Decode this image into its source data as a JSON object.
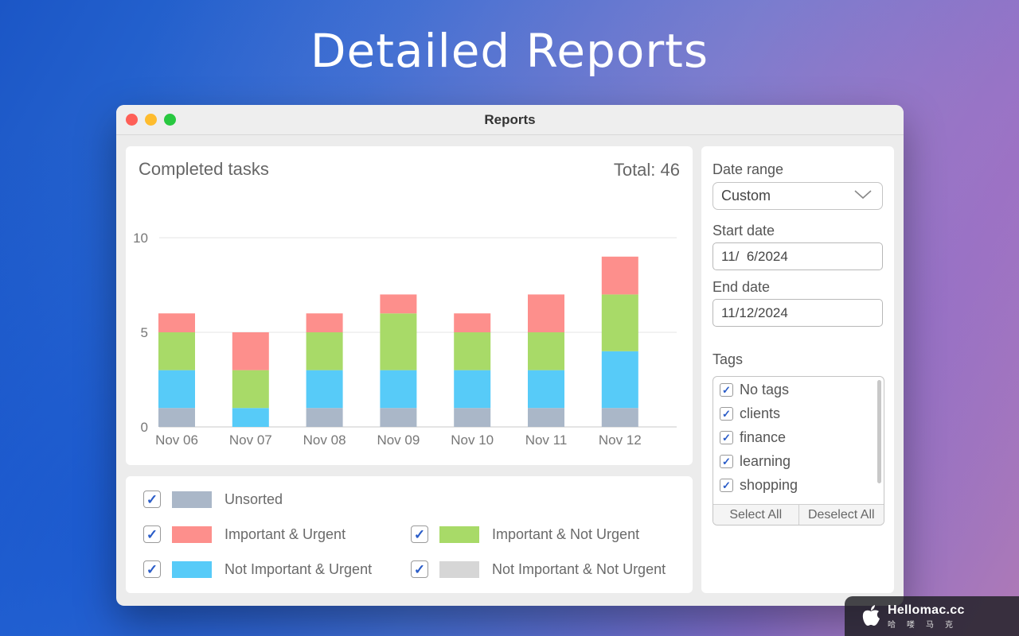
{
  "headline": "Detailed Reports",
  "window": {
    "title": "Reports"
  },
  "chart_panel": {
    "title": "Completed tasks",
    "total": "Total: 46"
  },
  "chart_data": {
    "type": "bar",
    "stacked": true,
    "title": "Completed tasks",
    "categories": [
      "Nov 06",
      "Nov 07",
      "Nov 08",
      "Nov 09",
      "Nov 10",
      "Nov 11",
      "Nov 12"
    ],
    "yticks": [
      0,
      5,
      10
    ],
    "ylim": [
      0,
      10
    ],
    "grid": true,
    "series": [
      {
        "name": "Unsorted",
        "color": "#aab7c8",
        "values": [
          1,
          0,
          1,
          1,
          1,
          1,
          1
        ]
      },
      {
        "name": "Not Important & Urgent",
        "color": "#57cbf8",
        "values": [
          2,
          1,
          2,
          2,
          2,
          2,
          3
        ]
      },
      {
        "name": "Important & Not Urgent",
        "color": "#a8da68",
        "values": [
          2,
          2,
          2,
          3,
          2,
          2,
          3
        ]
      },
      {
        "name": "Important & Urgent",
        "color": "#fd8f8c",
        "values": [
          1,
          2,
          1,
          1,
          1,
          2,
          2
        ]
      }
    ]
  },
  "legend": {
    "checkmark": "✓",
    "items": [
      {
        "label": "Unsorted",
        "color": "#aab7c8"
      },
      {
        "label": "Important & Urgent",
        "color": "#fd8f8c"
      },
      {
        "label": "Important & Not Urgent",
        "color": "#a8da68"
      },
      {
        "label": "Not Important & Urgent",
        "color": "#57cbf8"
      },
      {
        "label": "Not Important & Not Urgent",
        "color": "#d6d6d6"
      }
    ]
  },
  "sidebar": {
    "date_range_label": "Date range",
    "date_range_value": "Custom",
    "start_date_label": "Start date",
    "start_date_value": "11/  6/2024",
    "end_date_label": "End date",
    "end_date_value": "11/12/2024",
    "tags_label": "Tags",
    "tags": [
      "No tags",
      "clients",
      "finance",
      "learning",
      "shopping"
    ],
    "select_all": "Select All",
    "deselect_all": "Deselect All"
  },
  "watermark": {
    "name": "Hellomac.cc",
    "sub": "哈喽马克"
  }
}
